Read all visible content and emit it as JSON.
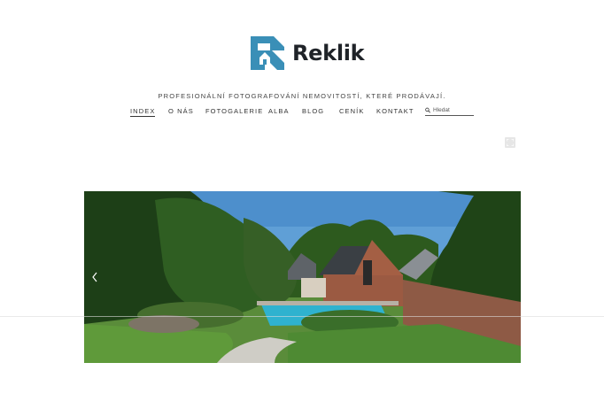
{
  "brand": {
    "name": "Reklik",
    "logo_icon": "reklik-house-r-logo",
    "accent": "#3a8fb7"
  },
  "tagline": "PROFESIONÁLNÍ FOTOGRAFOVÁNÍ NEMOVITOSTÍ, KTERÉ PRODÁVAJÍ.",
  "nav": {
    "items": [
      {
        "label": "INDEX",
        "active": true
      },
      {
        "label": "O NÁS",
        "active": false
      },
      {
        "label": "FOTOGALERIE",
        "active": false
      },
      {
        "label": "ALBA",
        "active": false
      },
      {
        "label": "BLOG",
        "active": false
      },
      {
        "label": "CENÍK",
        "active": false
      },
      {
        "label": "KONTAKT",
        "active": false
      }
    ]
  },
  "search": {
    "placeholder": "Hledat",
    "icon": "search-icon"
  },
  "hero": {
    "alt": "Dům se zahradou a bazénem",
    "prev_icon": "chevron-left-icon",
    "fullscreen_icon": "fullscreen-icon"
  }
}
